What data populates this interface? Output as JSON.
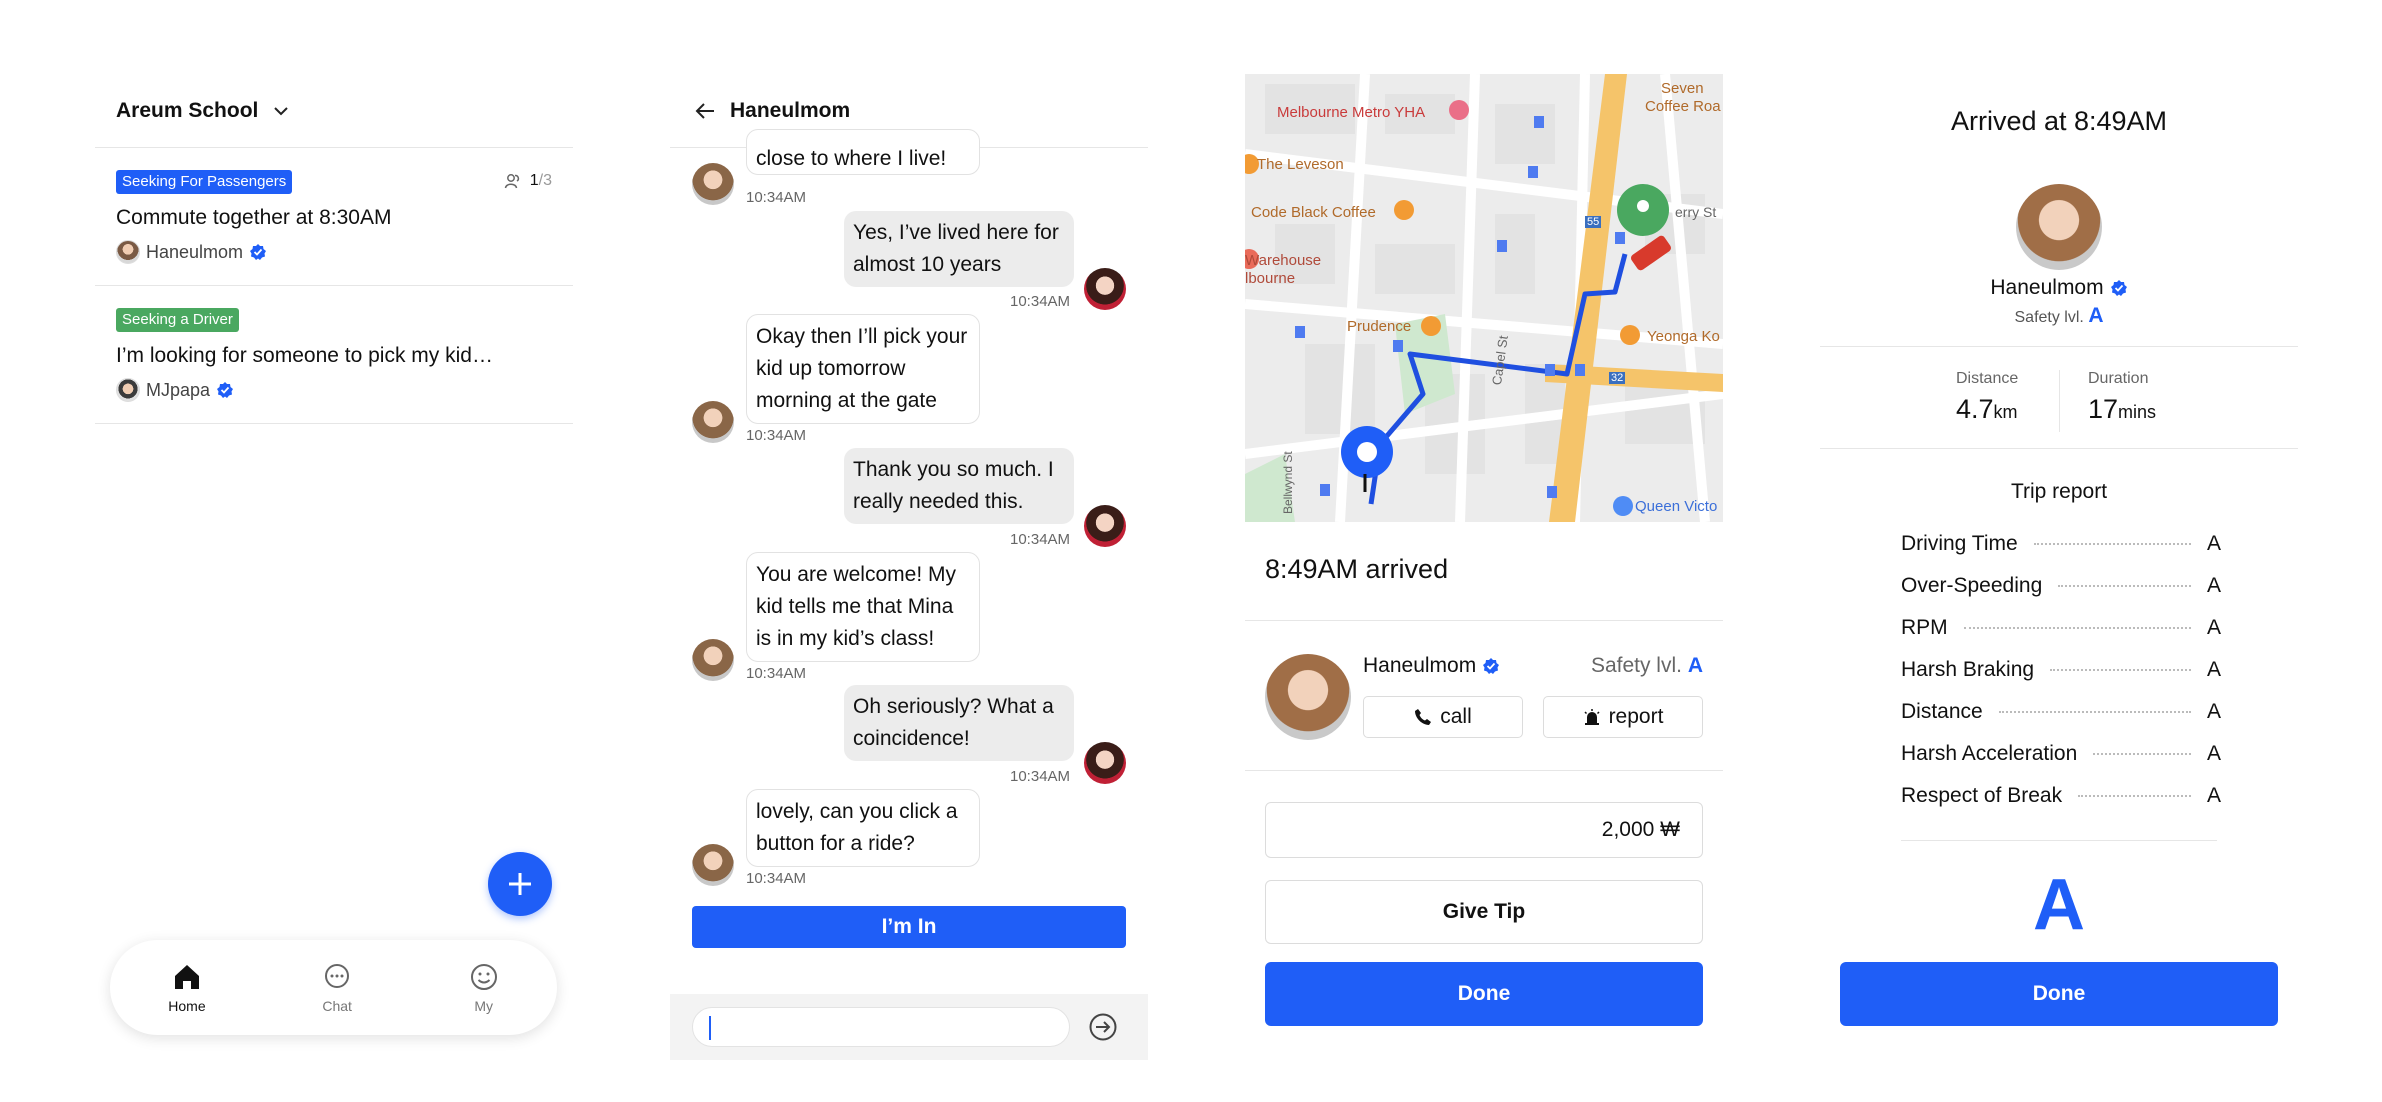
{
  "screen1": {
    "header_title": "Areum School",
    "posts": [
      {
        "badge": "Seeking For Passengers",
        "badge_color": "#1f5ef7",
        "count_current": "1",
        "count_total": "/3",
        "title": "Commute together at 8:30AM",
        "author": "Haneulmom"
      },
      {
        "badge": "Seeking a Driver",
        "badge_color": "#4aa860",
        "title": "I’m looking for someone to pick my kid…",
        "author": "MJpapa"
      }
    ],
    "nav": [
      {
        "label": "Home",
        "icon": "home-icon"
      },
      {
        "label": "Chat",
        "icon": "chat-icon"
      },
      {
        "label": "My",
        "icon": "smile-icon"
      }
    ]
  },
  "screen2": {
    "header_title": "Haneulmom",
    "messages": [
      {
        "from": "other",
        "text": "close to where I live!",
        "time": "10:34AM"
      },
      {
        "from": "me",
        "text": "Yes, I’ve lived here for almost 10 years",
        "time": "10:34AM"
      },
      {
        "from": "other",
        "text": "Okay then I’ll pick your kid up tomorrow morning at the gate",
        "time": "10:34AM"
      },
      {
        "from": "me",
        "text": "Thank you so much. I really needed this.",
        "time": "10:34AM"
      },
      {
        "from": "other",
        "text": "You are welcome! My kid tells me that Mina is in my kid’s class!",
        "time": "10:34AM"
      },
      {
        "from": "me",
        "text": "Oh seriously? What a coincidence!",
        "time": "10:34AM"
      },
      {
        "from": "other",
        "text": "lovely, can you click a button for a ride?",
        "time": "10:34AM"
      }
    ],
    "cta": "I’m In",
    "input_value": ""
  },
  "screen3": {
    "map_labels": {
      "yha": "Melbourne Metro YHA",
      "seven": "Seven",
      "coffee_roa": "Coffee Roa",
      "leveson": "The Leveson",
      "code_black": "Code Black Coffee",
      "warehouse": "Warehouse",
      "lbourne": "lbourne",
      "perry": "erry St",
      "prudence": "Prudence",
      "yeonga": "Yeonga Ko",
      "capel": "Capel St",
      "queen": "Queen Victo",
      "route55": "55",
      "route32": "32",
      "bellwynd": "Bellwynd St"
    },
    "arrived_text": "8:49AM arrived",
    "driver_name": "Haneulmom",
    "safety_label": "Safety lvl.",
    "safety_grade": "A",
    "call_label": "call",
    "report_label": "report",
    "tip_amount": "2,000 ₩",
    "give_tip_label": "Give Tip",
    "done_label": "Done"
  },
  "screen4": {
    "title": "Arrived at 8:49AM",
    "driver_name": "Haneulmom",
    "safety_label": "Safety lvl.",
    "safety_grade": "A",
    "distance_label": "Distance",
    "distance_value": "4.7",
    "distance_unit": "km",
    "duration_label": "Duration",
    "duration_value": "17",
    "duration_unit": "mins",
    "report_title": "Trip report",
    "report_rows": [
      {
        "name": "Driving Time",
        "grade": "A"
      },
      {
        "name": "Over-Speeding",
        "grade": "A"
      },
      {
        "name": "RPM",
        "grade": "A"
      },
      {
        "name": "Harsh Braking",
        "grade": "A"
      },
      {
        "name": "Distance",
        "grade": "A"
      },
      {
        "name": "Harsh Acceleration",
        "grade": "A"
      },
      {
        "name": "Respect of Break",
        "grade": "A"
      }
    ],
    "overall_grade": "A",
    "done_label": "Done"
  },
  "colors": {
    "accent": "#1f5ef7",
    "green_badge": "#4aa860",
    "route": "#1f4fe0",
    "road": "#f5c46a"
  }
}
